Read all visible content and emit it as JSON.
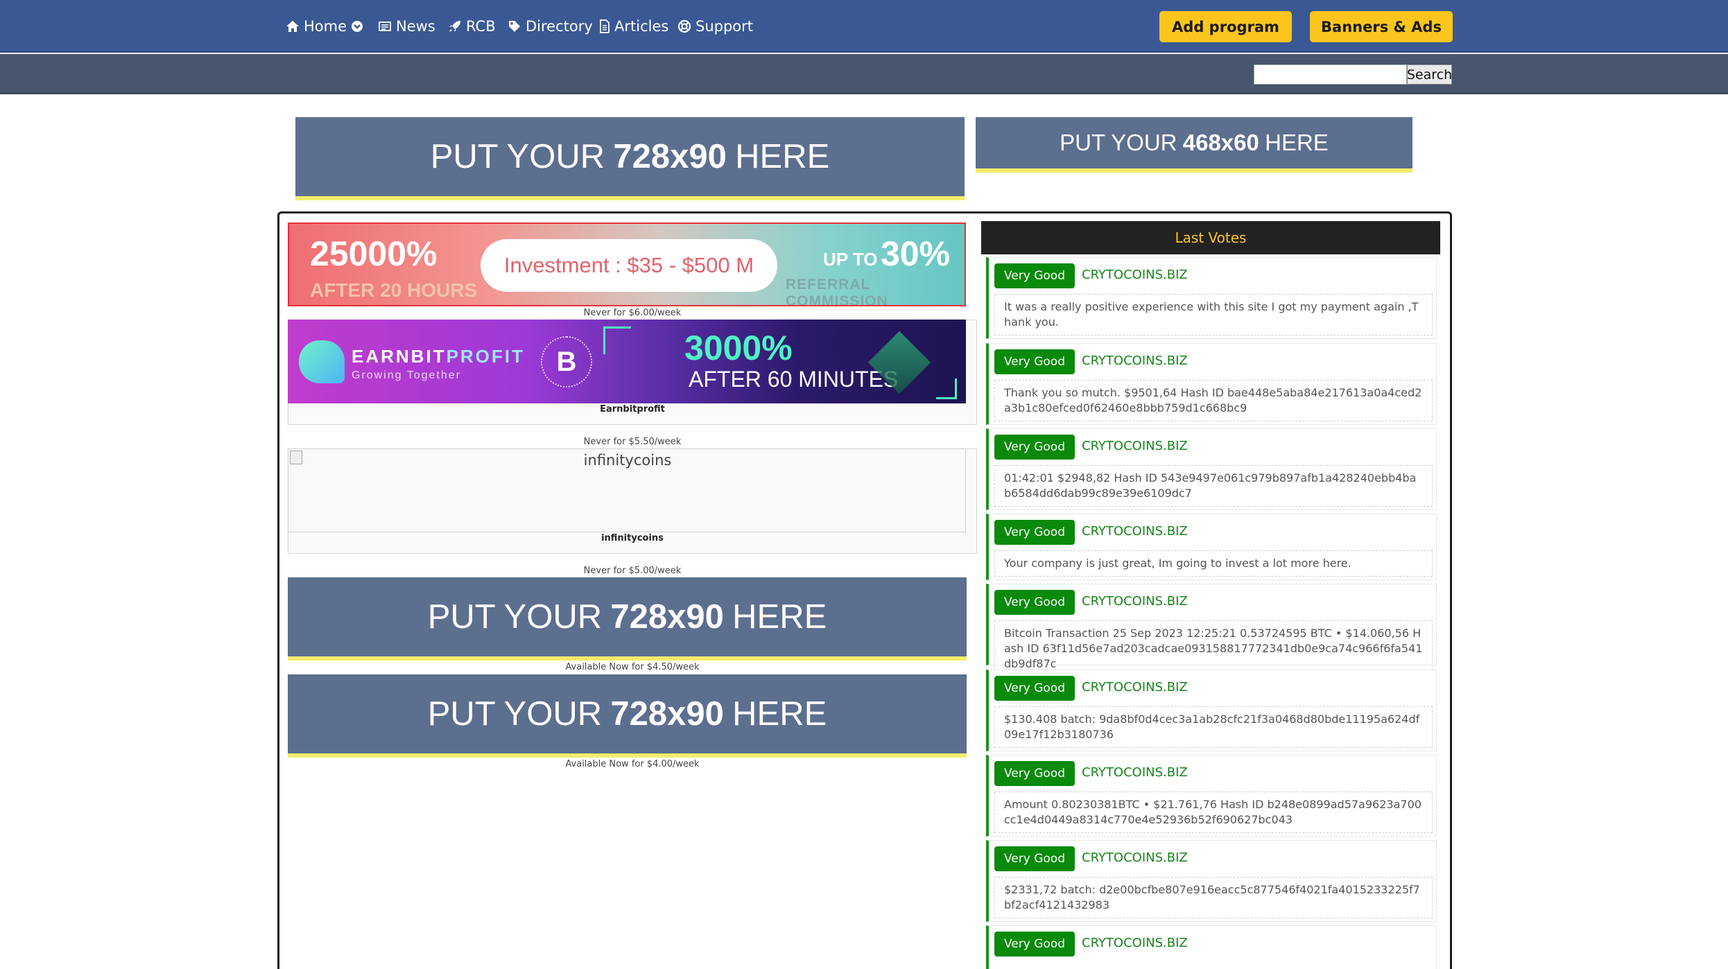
{
  "nav": {
    "home": "Home",
    "news": "News",
    "rcb": "RCB",
    "directory": "Directory",
    "articles": "Articles",
    "support": "Support",
    "add_program": "Add program",
    "banners_ads": "Banners & Ads"
  },
  "search": {
    "value": "",
    "button": "Search"
  },
  "top_banners": [
    {
      "prefix": "PUT YOUR",
      "size": "728x90",
      "suffix": "HERE"
    },
    {
      "prefix": "PUT YOUR",
      "size": "468x60",
      "suffix": "HERE"
    }
  ],
  "ads": {
    "ad1": {
      "percent": "25000%",
      "after": "AFTER 20 HOURS",
      "investment": "Investment : $35 - $500 M",
      "up_to": "UP TO",
      "ref_percent": "30%",
      "ref_label": "REFERRAL COMMISSION",
      "price": "Never for $6.00/week"
    },
    "ad2": {
      "brand_a": "EARNBIT",
      "brand_b": "PROFIT",
      "tagline": "Growing Together",
      "btc": "B",
      "percent": "3000%",
      "after": "AFTER 60 MINUTES",
      "caption": "Earnbitprofit",
      "price": "Never for $5.50/week"
    },
    "ad3": {
      "alt": "infinitycoins",
      "caption": "infinitycoins",
      "price": "Never for $5.00/week"
    },
    "slot4": {
      "prefix": "PUT YOUR",
      "size": "728x90",
      "suffix": "HERE",
      "price": "Available Now for $4.50/week"
    },
    "slot5": {
      "prefix": "PUT YOUR",
      "size": "728x90",
      "suffix": "HERE",
      "price": "Available Now for $4.00/week"
    }
  },
  "votes": {
    "title": "Last Votes",
    "items": [
      {
        "badge": "Very Good",
        "site": "CRYTOCOINS.BIZ",
        "text": "It was a really positive experience with this site I got my payment again ,Thank you."
      },
      {
        "badge": "Very Good",
        "site": "CRYTOCOINS.BIZ",
        "text": "Thank you so mutch. $9501,64 Hash ID bae448e5aba84e217613a0a4ced2a3b1c80efced0f62460e8bbb759d1c668bc9"
      },
      {
        "badge": "Very Good",
        "site": "CRYTOCOINS.BIZ",
        "text": "01:42:01 $2948,82 Hash ID 543e9497e061c979b897afb1a428240ebb4bab6584dd6dab99c89e39e6109dc7"
      },
      {
        "badge": "Very Good",
        "site": "CRYTOCOINS.BIZ",
        "text": "Your company is just great, Im going to invest a lot more here."
      },
      {
        "badge": "Very Good",
        "site": "CRYTOCOINS.BIZ",
        "text": "Bitcoin Transaction 25 Sep 2023 12:25:21 0.53724595 BTC • $14.060,56 Hash ID 63f11d56e7ad203cadcae093158817772341db0e9ca74c966f6fa541db9df87c"
      },
      {
        "badge": "Very Good",
        "site": "CRYTOCOINS.BIZ",
        "text": "$130.408 batch: 9da8bf0d4cec3a1ab28cfc21f3a0468d80bde11195a624df09e17f12b3180736"
      },
      {
        "badge": "Very Good",
        "site": "CRYTOCOINS.BIZ",
        "text": "Amount 0.80230381BTC • $21.761,76 Hash ID b248e0899ad57a9623a700cc1e4d0449a8314c770e4e52936b52f690627bc043"
      },
      {
        "badge": "Very Good",
        "site": "CRYTOCOINS.BIZ",
        "text": "$2331,72 batch: d2e00bcfbe807e916eacc5c877546f4021fa4015233225f7bf2acf4121432983"
      },
      {
        "badge": "Very Good",
        "site": "CRYTOCOINS.BIZ",
        "text": ""
      }
    ]
  }
}
